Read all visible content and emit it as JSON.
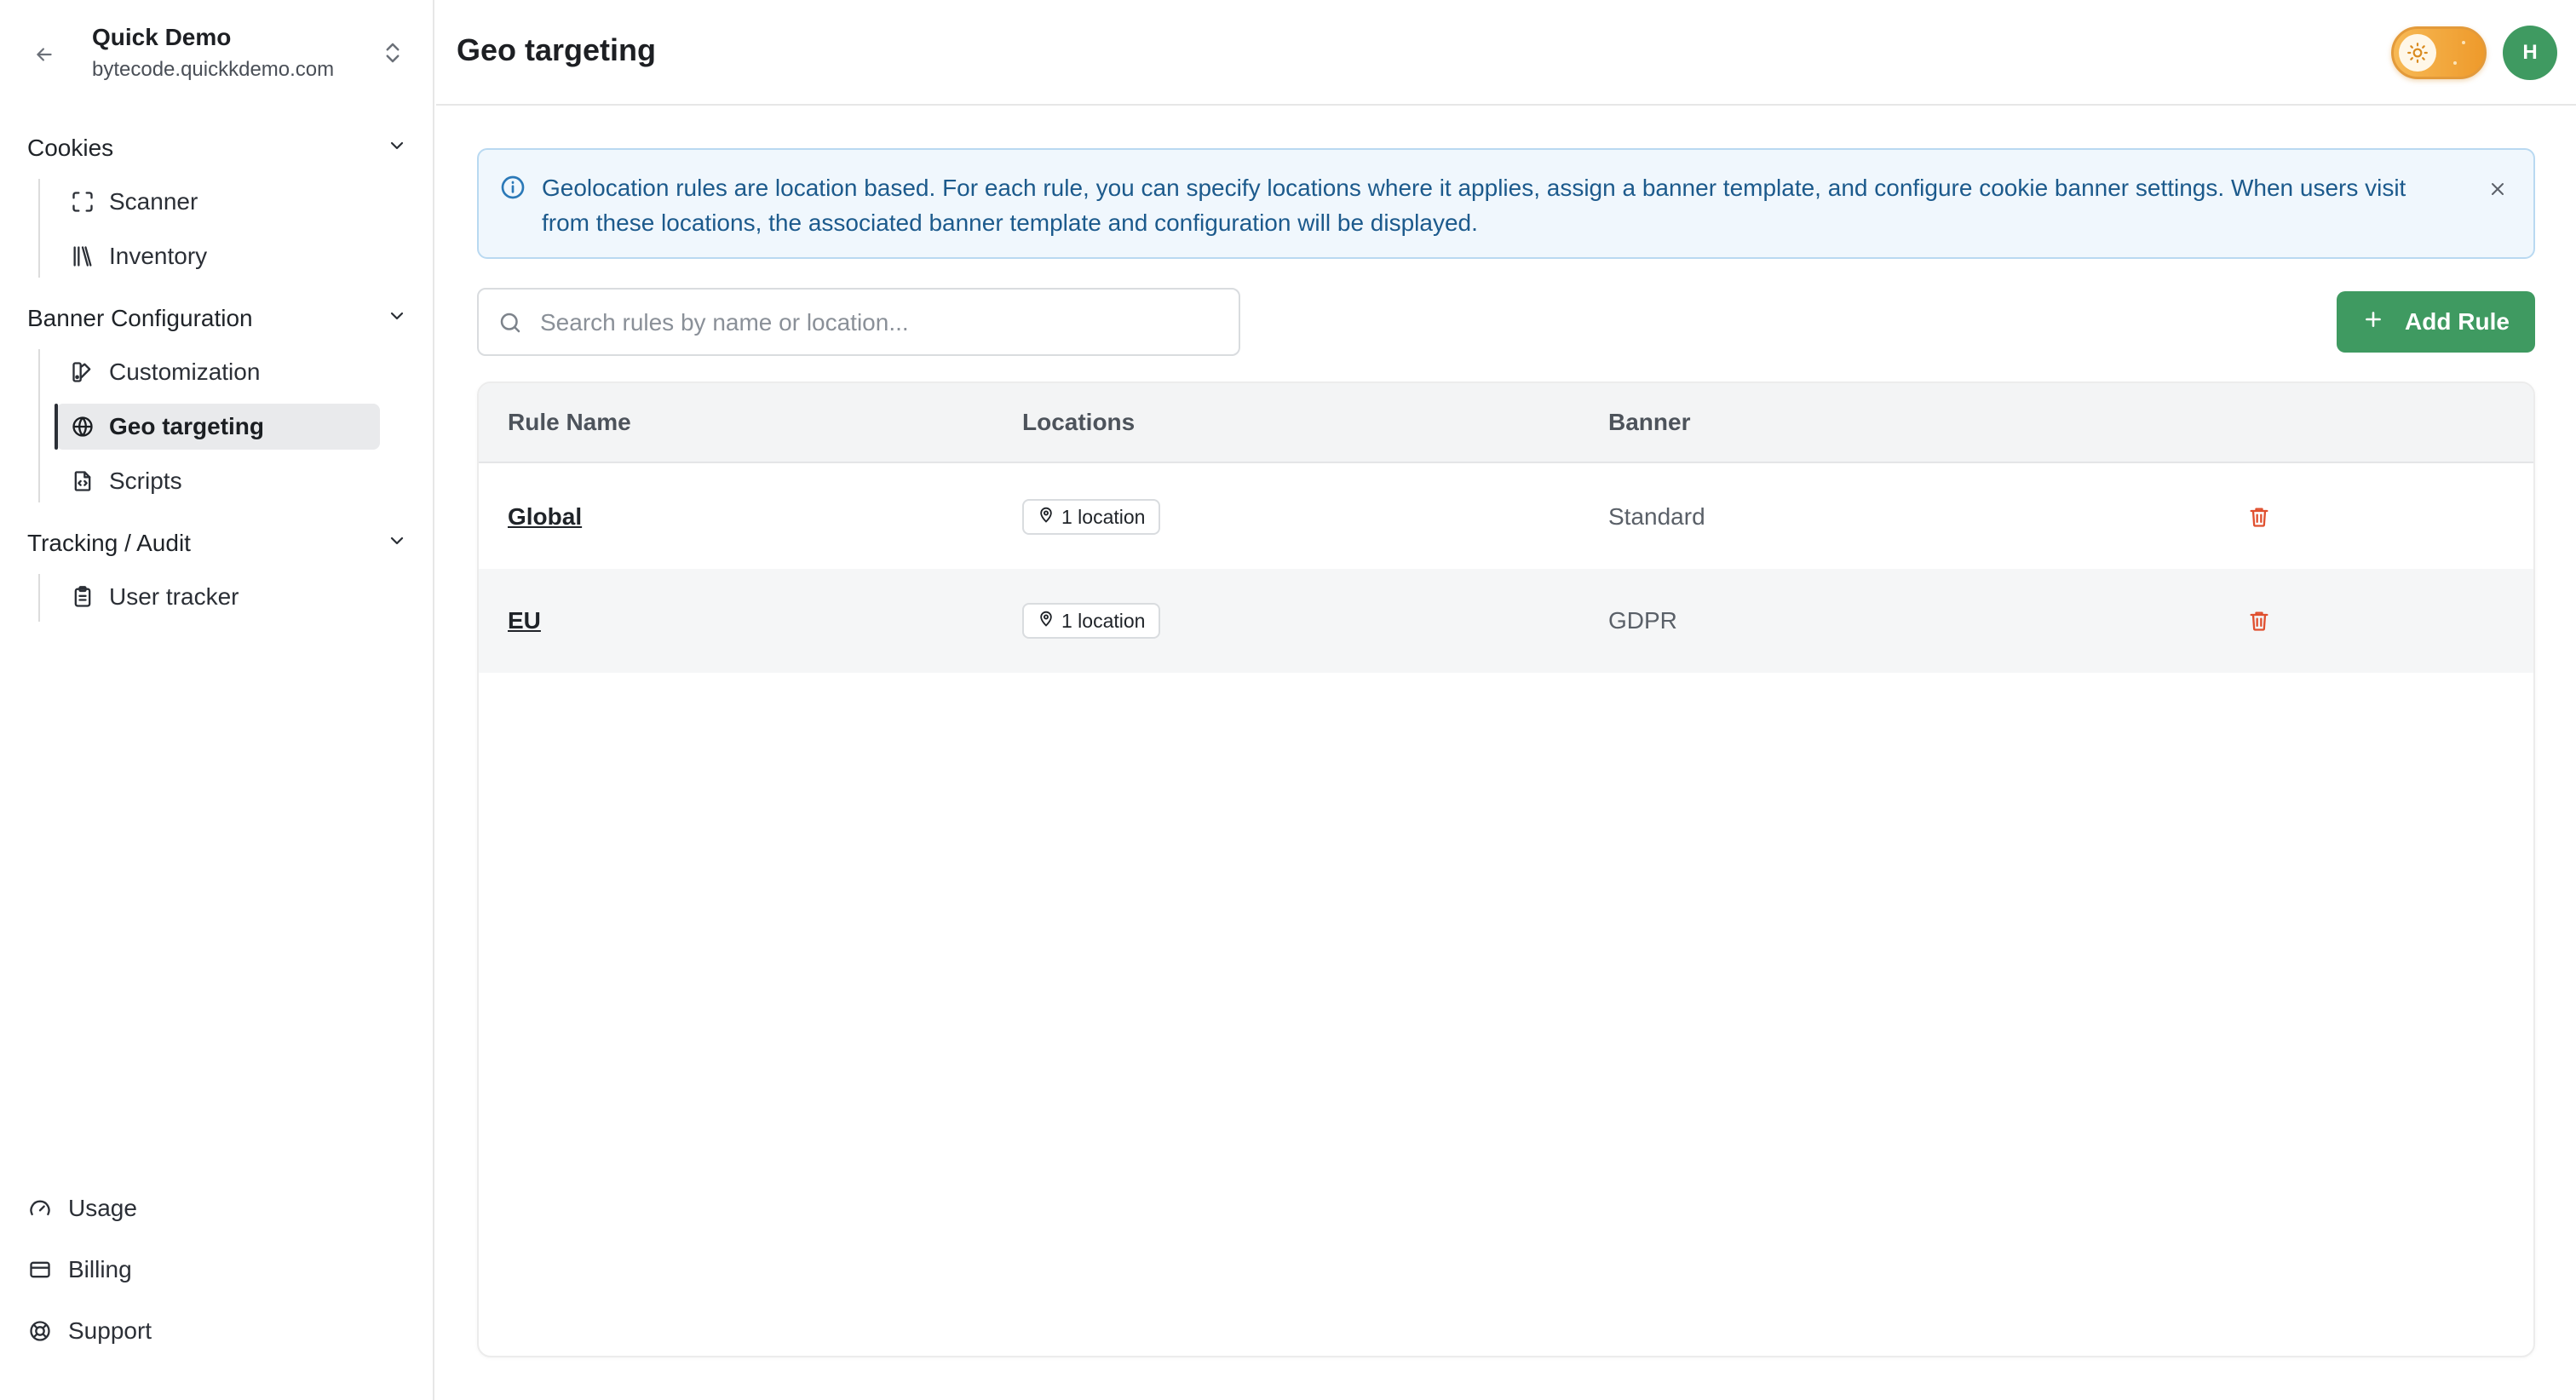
{
  "workspace": {
    "name": "Quick Demo",
    "domain": "bytecode.quickkdemo.com"
  },
  "sidebar": {
    "groups": [
      {
        "label": "Cookies",
        "items": [
          {
            "label": "Scanner",
            "icon": "scan-icon"
          },
          {
            "label": "Inventory",
            "icon": "library-icon"
          }
        ]
      },
      {
        "label": "Banner Configuration",
        "items": [
          {
            "label": "Customization",
            "icon": "palette-icon"
          },
          {
            "label": "Geo targeting",
            "icon": "globe-icon",
            "active": true
          },
          {
            "label": "Scripts",
            "icon": "file-code-icon"
          }
        ]
      },
      {
        "label": "Tracking / Audit",
        "items": [
          {
            "label": "User tracker",
            "icon": "clipboard-icon"
          }
        ]
      }
    ],
    "bottom": [
      {
        "label": "Usage",
        "icon": "gauge-icon"
      },
      {
        "label": "Billing",
        "icon": "credit-card-icon"
      },
      {
        "label": "Support",
        "icon": "life-buoy-icon"
      }
    ]
  },
  "header": {
    "title": "Geo targeting",
    "avatar_initial": "H",
    "theme": "light"
  },
  "info": {
    "text": "Geolocation rules are location based. For each rule, you can specify locations where it applies, assign a banner template, and configure cookie banner settings. When users visit from these locations, the associated banner template and configuration will be displayed."
  },
  "search": {
    "placeholder": "Search rules by name or location...",
    "value": ""
  },
  "actions": {
    "add_label": "Add Rule"
  },
  "table": {
    "columns": [
      "Rule Name",
      "Locations",
      "Banner"
    ],
    "rows": [
      {
        "name": "Global",
        "locations": "1 location",
        "banner": "Standard"
      },
      {
        "name": "EU",
        "locations": "1 location",
        "banner": "GDPR"
      }
    ]
  },
  "colors": {
    "accent_green": "#3f9a61",
    "info_bg": "#f0f7fd",
    "info_text": "#1c5a8c",
    "delete_red": "#e0502f",
    "toggle_orange": "#f0a33a"
  }
}
